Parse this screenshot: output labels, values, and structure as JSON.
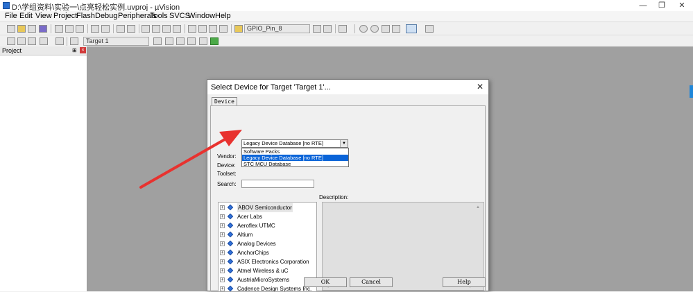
{
  "window": {
    "title": "D:\\学组资料\\实验一\\点亮轻松实例.uvproj - µVision",
    "minimize_glyph": "—",
    "restore_glyph": "❐",
    "close_glyph": "✕"
  },
  "menu": [
    "File",
    "Edit",
    "View",
    "Project",
    "Flash",
    "Debug",
    "Peripherals",
    "Tools",
    "SVCS",
    "Window",
    "Help"
  ],
  "toolbar": {
    "find_combo": "GPIO_Pin_8",
    "target_combo": "Target 1"
  },
  "project_panel": {
    "title": "Project",
    "pin_glyph": "⊞",
    "close_glyph": "×"
  },
  "dialog": {
    "title": "Select Device for Target 'Target 1'...",
    "close_glyph": "✕",
    "tab": "Device",
    "database_select": "Legacy Device Database [no RTE]",
    "dropdown_options": [
      "Software Packs",
      "Legacy Device Database [no RTE]",
      "STC MCU Database"
    ],
    "labels": {
      "vendor": "Vendor:",
      "device": "Device:",
      "toolset": "Toolset:",
      "search": "Search:",
      "description": "Description:"
    },
    "vendors": [
      "ABOV Semiconductor",
      "Acer Labs",
      "Aeroflex UTMC",
      "Altium",
      "Analog Devices",
      "AnchorChips",
      "ASIX Electronics Corporation",
      "Atmel Wireless & uC",
      "AustriaMicroSystems",
      "Cadence Design Systems Inc."
    ],
    "buttons": {
      "ok": "OK",
      "cancel": "Cancel",
      "help": "Help"
    }
  },
  "colors": {
    "selection": "#0a64d8",
    "annotation_arrow": "#e8322f",
    "workspace": "#a0a0a0"
  }
}
